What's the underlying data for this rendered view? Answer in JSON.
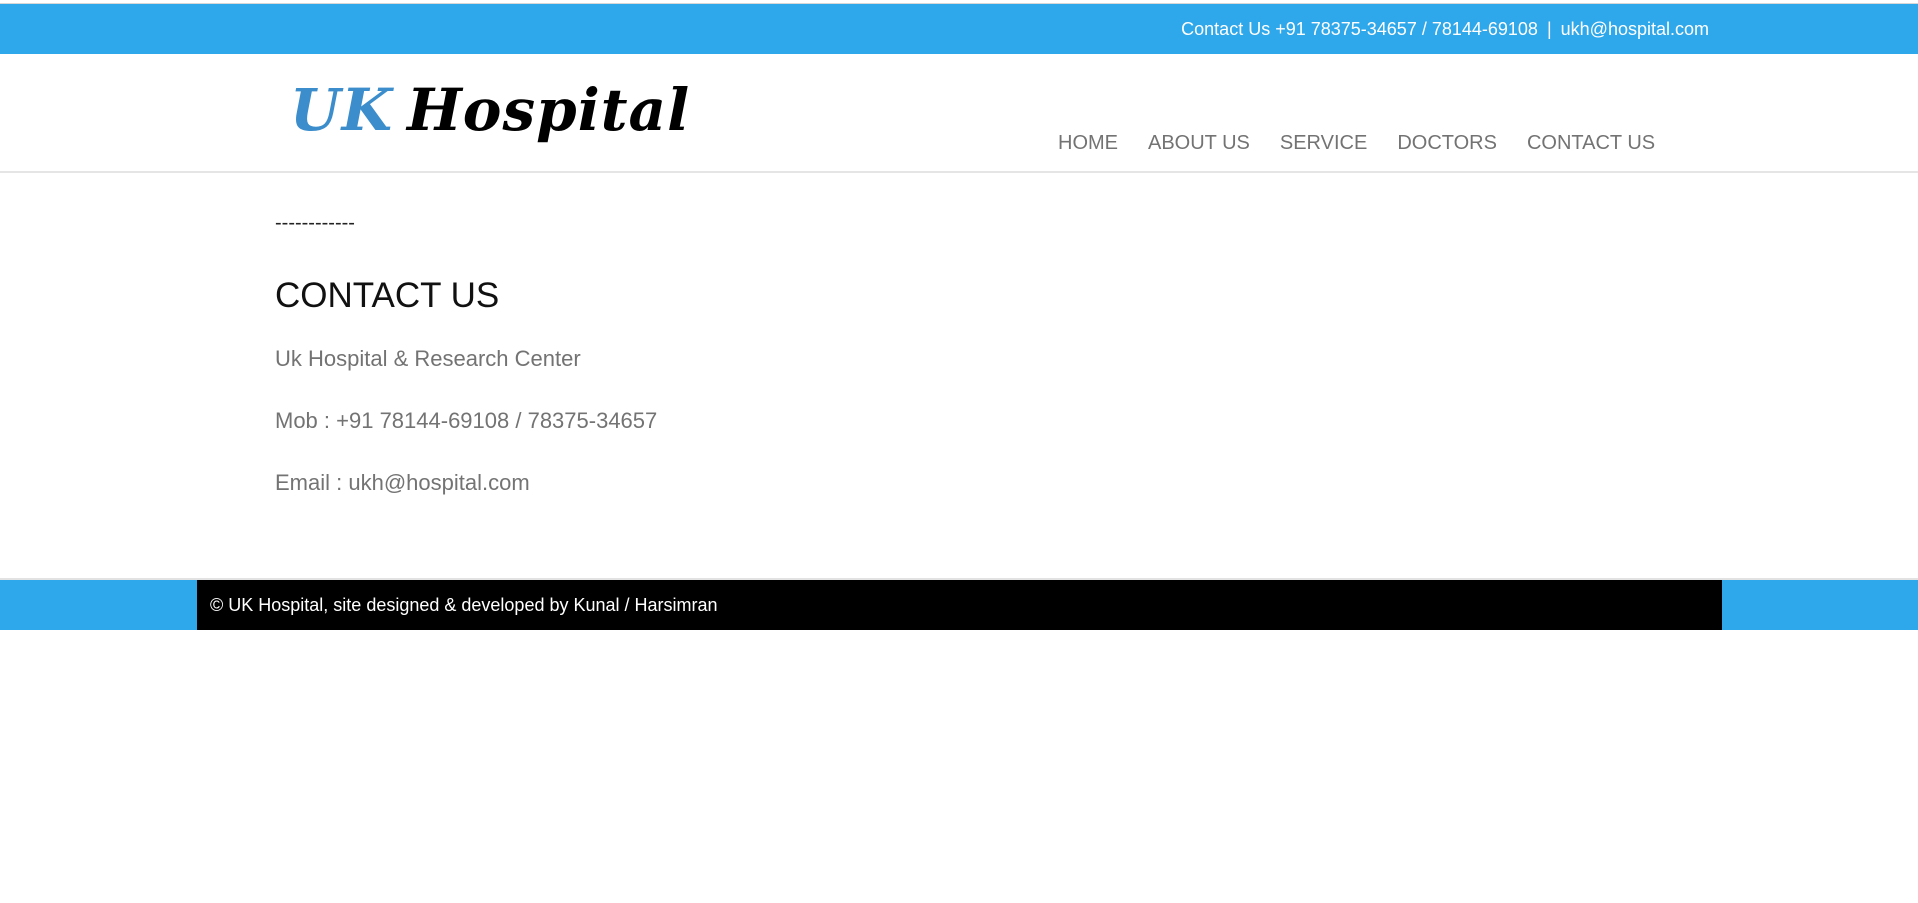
{
  "topbar": {
    "contact_label": "Contact Us +91 78375-34657 / 78144-69108",
    "separator": "|",
    "email": "ukh@hospital.com"
  },
  "header": {
    "logo_part1": "UK",
    "logo_part2": "Hospital",
    "nav": [
      "HOME",
      "ABOUT US",
      "SERVICE",
      "DOCTORS",
      "CONTACT US"
    ]
  },
  "main": {
    "dashes": "------------",
    "title": "CONTACT US",
    "line1": "Uk Hospital & Research Center",
    "line2": "Mob : +91 78144-69108 / 78375-34657",
    "line3": "Email : ukh@hospital.com"
  },
  "footer": {
    "text": "© UK Hospital, site designed & developed by Kunal / Harsimran"
  },
  "colors": {
    "accent": "#2fa7eb",
    "logo_blue": "#3c8dcc",
    "nav_text": "#737373",
    "footer_bg": "#000000"
  }
}
